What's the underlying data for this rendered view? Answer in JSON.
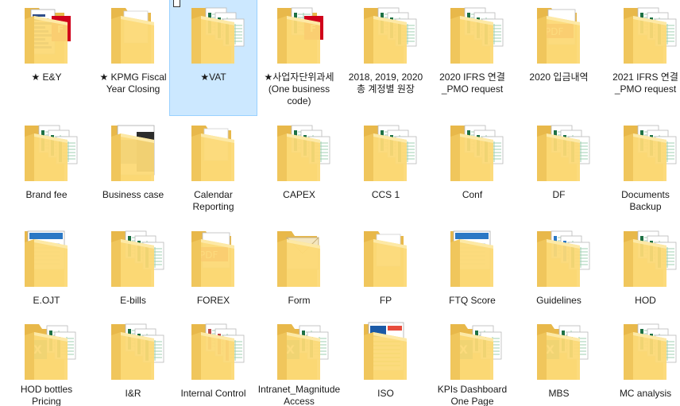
{
  "view": "large-icons",
  "colors": {
    "selection": "#cce8ff",
    "folder_back": "#e8b84a",
    "folder_front": "#fcd976",
    "excel": "#1e7145",
    "pdf": "#d0021b"
  },
  "items": [
    {
      "label": "★ E&Y",
      "icon": "folder-icon",
      "preview": "doc-pdf"
    },
    {
      "label": "★ KPMG Fiscal Year Closing",
      "icon": "folder-icon",
      "preview": "plain"
    },
    {
      "label": "★VAT",
      "icon": "folder-icon",
      "preview": "sheets",
      "selected": true
    },
    {
      "label": "★사업자단위과세(One business code)",
      "icon": "folder-icon",
      "preview": "sheets-pdf"
    },
    {
      "label": "2018, 2019, 2020 총 계정별 원장",
      "icon": "folder-icon",
      "preview": "sheets"
    },
    {
      "label": "2020 IFRS 연결_PMO request",
      "icon": "folder-icon",
      "preview": "sheets"
    },
    {
      "label": "2020 입금내역",
      "icon": "folder-icon",
      "preview": "pdf"
    },
    {
      "label": "2021 IFRS 연결_PMO request",
      "icon": "folder-icon",
      "preview": "sheets"
    },
    {
      "label": "Brand fee",
      "icon": "folder-icon",
      "preview": "sheets"
    },
    {
      "label": "Business case",
      "icon": "folder-icon",
      "preview": "slides"
    },
    {
      "label": "Calendar Reporting",
      "icon": "folder-icon",
      "preview": "plain"
    },
    {
      "label": "CAPEX",
      "icon": "folder-icon",
      "preview": "sheets"
    },
    {
      "label": "CCS 1",
      "icon": "folder-icon",
      "preview": "sheets"
    },
    {
      "label": "Conf",
      "icon": "folder-icon",
      "preview": "sheets"
    },
    {
      "label": "DF",
      "icon": "folder-icon",
      "preview": "sheets"
    },
    {
      "label": "Documents Backup",
      "icon": "folder-icon",
      "preview": "sheets"
    },
    {
      "label": "E.OJT",
      "icon": "folder-icon",
      "preview": "doc-blue"
    },
    {
      "label": "E-bills",
      "icon": "folder-icon",
      "preview": "sheets"
    },
    {
      "label": "FOREX",
      "icon": "folder-icon",
      "preview": "pdf"
    },
    {
      "label": "Form",
      "icon": "folder-icon",
      "preview": "envelope"
    },
    {
      "label": "FP",
      "icon": "folder-icon",
      "preview": "plain"
    },
    {
      "label": "FTQ Score",
      "icon": "folder-icon",
      "preview": "doc-blue"
    },
    {
      "label": "Guidelines",
      "icon": "folder-icon",
      "preview": "sheets-blue"
    },
    {
      "label": "HOD",
      "icon": "folder-icon",
      "preview": "sheets"
    },
    {
      "label": "HOD bottles Pricing",
      "icon": "folder-icon",
      "preview": "excel"
    },
    {
      "label": "I&R",
      "icon": "folder-icon",
      "preview": "sheets"
    },
    {
      "label": "Internal Control",
      "icon": "folder-icon",
      "preview": "sheets-red"
    },
    {
      "label": "Intranet_Magnitude Access",
      "icon": "folder-icon",
      "preview": "excel"
    },
    {
      "label": "ISO",
      "icon": "folder-icon",
      "preview": "doc-color"
    },
    {
      "label": "KPIs Dashboard One Page",
      "icon": "folder-icon",
      "preview": "excel"
    },
    {
      "label": "MBS",
      "icon": "folder-icon",
      "preview": "excel"
    },
    {
      "label": "MC analysis",
      "icon": "folder-icon",
      "preview": "sheets"
    }
  ]
}
